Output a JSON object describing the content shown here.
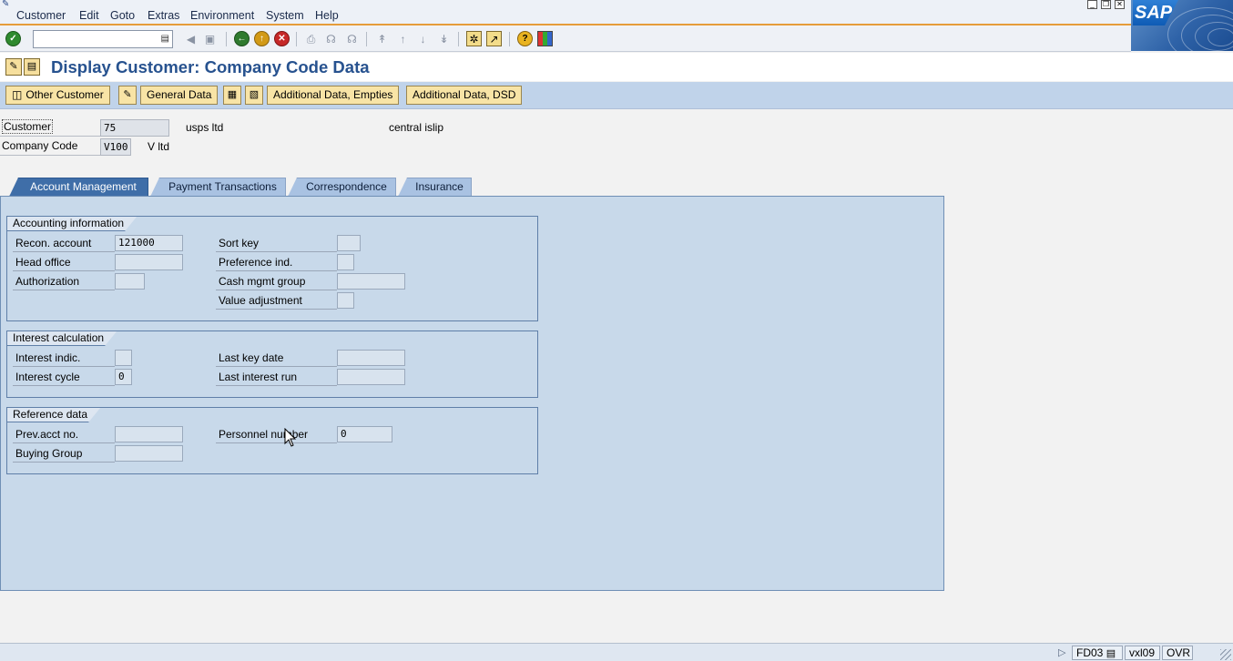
{
  "menu": [
    "Customer",
    "Edit",
    "Goto",
    "Extras",
    "Environment",
    "System",
    "Help"
  ],
  "logo_text": "SAP",
  "toolbar": {
    "command_field_value": "",
    "icons": [
      "enter-icon",
      "back-icon",
      "exit-icon",
      "cancel-icon",
      "print-icon",
      "find-icon",
      "find-next-icon",
      "first-page-icon",
      "previous-page-icon",
      "next-page-icon",
      "last-page-icon",
      "create-session-icon",
      "shortcut-icon",
      "help-icon",
      "customize-layout-icon"
    ]
  },
  "title": "Display Customer: Company Code Data",
  "app_toolbar": {
    "other_customer": "Other Customer",
    "general_data": "General Data",
    "additional_empties": "Additional Data, Empties",
    "additional_dsd": "Additional Data, DSD"
  },
  "header": {
    "customer_label": "Customer",
    "customer_value": "75",
    "customer_name": "usps ltd",
    "customer_city": "central islip",
    "company_code_label": "Company Code",
    "company_code_value": "V100",
    "company_code_name": "V ltd"
  },
  "tabs": [
    "Account Management",
    "Payment Transactions",
    "Correspondence",
    "Insurance"
  ],
  "active_tab": "Account Management",
  "accounting": {
    "title": "Accounting information",
    "recon_label": "Recon. account",
    "recon_value": "121000",
    "head_office_label": "Head office",
    "head_office_value": "",
    "authorization_label": "Authorization",
    "authorization_value": "",
    "sort_key_label": "Sort key",
    "sort_key_value": "",
    "preference_label": "Preference ind.",
    "preference_value": "",
    "cash_mgmt_label": "Cash mgmt group",
    "cash_mgmt_value": "",
    "value_adj_label": "Value adjustment",
    "value_adj_value": ""
  },
  "interest": {
    "title": "Interest calculation",
    "indic_label": "Interest indic.",
    "indic_value": "",
    "cycle_label": "Interest cycle",
    "cycle_value": "0",
    "last_key_label": "Last key date",
    "last_key_value": "",
    "last_run_label": "Last interest run",
    "last_run_value": ""
  },
  "reference": {
    "title": "Reference data",
    "prev_acct_label": "Prev.acct no.",
    "prev_acct_value": "",
    "buying_group_label": "Buying Group",
    "buying_group_value": "",
    "personnel_label": "Personnel number",
    "personnel_value": "0"
  },
  "status": {
    "transaction": "FD03",
    "server": "vxl09",
    "mode": "OVR"
  }
}
